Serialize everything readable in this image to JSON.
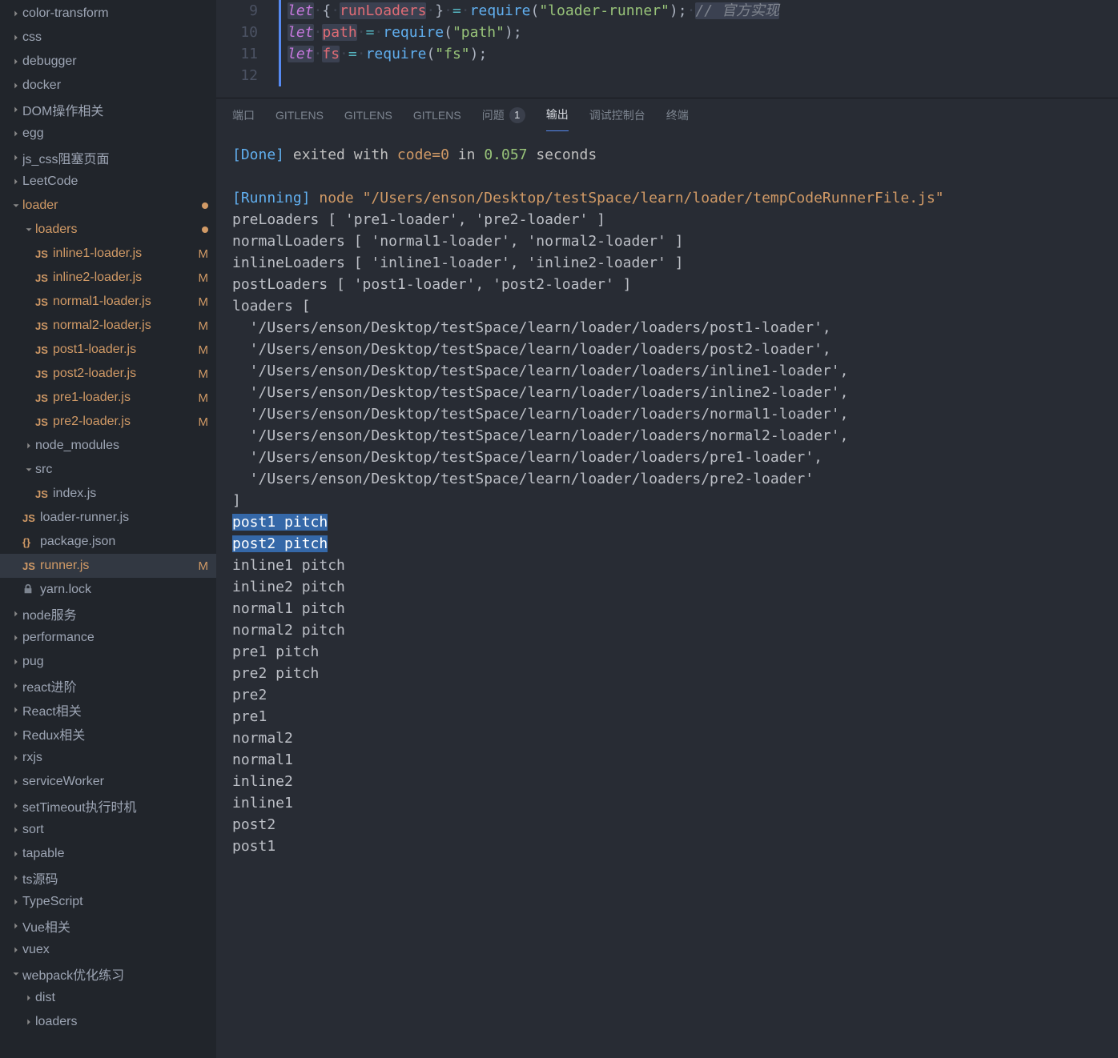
{
  "sidebar": {
    "items": [
      {
        "kind": "folder",
        "expanded": false,
        "depth": 0,
        "name": "color-transform"
      },
      {
        "kind": "folder",
        "expanded": false,
        "depth": 0,
        "name": "css"
      },
      {
        "kind": "folder",
        "expanded": false,
        "depth": 0,
        "name": "debugger"
      },
      {
        "kind": "folder",
        "expanded": false,
        "depth": 0,
        "name": "docker"
      },
      {
        "kind": "folder",
        "expanded": false,
        "depth": 0,
        "name": "DOM操作相关"
      },
      {
        "kind": "folder",
        "expanded": false,
        "depth": 0,
        "name": "egg"
      },
      {
        "kind": "folder",
        "expanded": false,
        "depth": 0,
        "name": "js_css阻塞页面"
      },
      {
        "kind": "folder",
        "expanded": false,
        "depth": 0,
        "name": "LeetCode"
      },
      {
        "kind": "folder",
        "expanded": true,
        "depth": 0,
        "name": "loader",
        "dot": true,
        "mod": true
      },
      {
        "kind": "folder",
        "expanded": true,
        "depth": 1,
        "name": "loaders",
        "dot": true,
        "mod": true
      },
      {
        "kind": "file",
        "icon": "JS",
        "depth": 2,
        "name": "inline1-loader.js",
        "mod": true,
        "marker": "M"
      },
      {
        "kind": "file",
        "icon": "JS",
        "depth": 2,
        "name": "inline2-loader.js",
        "mod": true,
        "marker": "M"
      },
      {
        "kind": "file",
        "icon": "JS",
        "depth": 2,
        "name": "normal1-loader.js",
        "mod": true,
        "marker": "M"
      },
      {
        "kind": "file",
        "icon": "JS",
        "depth": 2,
        "name": "normal2-loader.js",
        "mod": true,
        "marker": "M"
      },
      {
        "kind": "file",
        "icon": "JS",
        "depth": 2,
        "name": "post1-loader.js",
        "mod": true,
        "marker": "M"
      },
      {
        "kind": "file",
        "icon": "JS",
        "depth": 2,
        "name": "post2-loader.js",
        "mod": true,
        "marker": "M"
      },
      {
        "kind": "file",
        "icon": "JS",
        "depth": 2,
        "name": "pre1-loader.js",
        "mod": true,
        "marker": "M"
      },
      {
        "kind": "file",
        "icon": "JS",
        "depth": 2,
        "name": "pre2-loader.js",
        "mod": true,
        "marker": "M"
      },
      {
        "kind": "folder",
        "expanded": false,
        "depth": 1,
        "name": "node_modules"
      },
      {
        "kind": "folder",
        "expanded": true,
        "depth": 1,
        "name": "src"
      },
      {
        "kind": "file",
        "icon": "JS",
        "depth": 2,
        "name": "index.js"
      },
      {
        "kind": "file",
        "icon": "JS",
        "depth": 1,
        "name": "loader-runner.js"
      },
      {
        "kind": "file",
        "icon": "{}",
        "depth": 1,
        "name": "package.json"
      },
      {
        "kind": "file",
        "icon": "JS",
        "depth": 1,
        "name": "runner.js",
        "mod": true,
        "marker": "M",
        "selected": true
      },
      {
        "kind": "file",
        "icon": "🔒",
        "depth": 1,
        "name": "yarn.lock"
      },
      {
        "kind": "folder",
        "expanded": false,
        "depth": 0,
        "name": "node服务"
      },
      {
        "kind": "folder",
        "expanded": false,
        "depth": 0,
        "name": "performance"
      },
      {
        "kind": "folder",
        "expanded": false,
        "depth": 0,
        "name": "pug"
      },
      {
        "kind": "folder",
        "expanded": false,
        "depth": 0,
        "name": "react进阶"
      },
      {
        "kind": "folder",
        "expanded": false,
        "depth": 0,
        "name": "React相关"
      },
      {
        "kind": "folder",
        "expanded": false,
        "depth": 0,
        "name": "Redux相关"
      },
      {
        "kind": "folder",
        "expanded": false,
        "depth": 0,
        "name": "rxjs"
      },
      {
        "kind": "folder",
        "expanded": false,
        "depth": 0,
        "name": "serviceWorker"
      },
      {
        "kind": "folder",
        "expanded": false,
        "depth": 0,
        "name": "setTimeout执行时机"
      },
      {
        "kind": "folder",
        "expanded": false,
        "depth": 0,
        "name": "sort"
      },
      {
        "kind": "folder",
        "expanded": false,
        "depth": 0,
        "name": "tapable"
      },
      {
        "kind": "folder",
        "expanded": false,
        "depth": 0,
        "name": "ts源码"
      },
      {
        "kind": "folder",
        "expanded": false,
        "depth": 0,
        "name": "TypeScript"
      },
      {
        "kind": "folder",
        "expanded": false,
        "depth": 0,
        "name": "Vue相关"
      },
      {
        "kind": "folder",
        "expanded": false,
        "depth": 0,
        "name": "vuex"
      },
      {
        "kind": "folder",
        "expanded": true,
        "depth": 0,
        "name": "webpack优化练习"
      },
      {
        "kind": "folder",
        "expanded": false,
        "depth": 1,
        "name": "dist"
      },
      {
        "kind": "folder",
        "expanded": false,
        "depth": 1,
        "name": "loaders"
      }
    ]
  },
  "editor": {
    "lineNumbers": [
      "9",
      "10",
      "11",
      "12"
    ],
    "code": {
      "l9_let": "let",
      "l9_lb": "{",
      "l9_id": "runLoaders",
      "l9_rb": "}",
      "l9_eq": "=",
      "l9_req": "require",
      "l9_lp": "(",
      "l9_str": "\"loader-runner\"",
      "l9_rp": ")",
      "l9_sc": ";",
      "l9_cmt": "// 官方实现",
      "l10_let": "let",
      "l10_id": "path",
      "l10_eq": "=",
      "l10_req": "require",
      "l10_lp": "(",
      "l10_str": "\"path\"",
      "l10_rp": ")",
      "l10_sc": ";",
      "l11_let": "let",
      "l11_id": "fs",
      "l11_eq": "=",
      "l11_req": "require",
      "l11_lp": "(",
      "l11_str": "\"fs\"",
      "l11_rp": ")",
      "l11_sc": ";"
    }
  },
  "panel": {
    "tabs": {
      "ports": "端口",
      "gitlens1": "GITLENS",
      "gitlens2": "GITLENS",
      "gitlens3": "GITLENS",
      "problems": "问题",
      "problems_count": "1",
      "output": "输出",
      "debug": "调试控制台",
      "terminal": "终端"
    }
  },
  "output": {
    "done_label": "[Done]",
    "done_rest": " exited with ",
    "done_code": "code=0",
    "done_rest2": " in ",
    "done_time": "0.057",
    "done_sec": " seconds",
    "running_label": "[Running]",
    "running_cmd": " node \"/Users/enson/Desktop/testSpace/learn/loader/tempCodeRunnerFile.js\"",
    "lines": [
      "preLoaders [ 'pre1-loader', 'pre2-loader' ]",
      "normalLoaders [ 'normal1-loader', 'normal2-loader' ]",
      "inlineLoaders [ 'inline1-loader', 'inline2-loader' ]",
      "postLoaders [ 'post1-loader', 'post2-loader' ]",
      "loaders [",
      "  '/Users/enson/Desktop/testSpace/learn/loader/loaders/post1-loader',",
      "  '/Users/enson/Desktop/testSpace/learn/loader/loaders/post2-loader',",
      "  '/Users/enson/Desktop/testSpace/learn/loader/loaders/inline1-loader',",
      "  '/Users/enson/Desktop/testSpace/learn/loader/loaders/inline2-loader',",
      "  '/Users/enson/Desktop/testSpace/learn/loader/loaders/normal1-loader',",
      "  '/Users/enson/Desktop/testSpace/learn/loader/loaders/normal2-loader',",
      "  '/Users/enson/Desktop/testSpace/learn/loader/loaders/pre1-loader',",
      "  '/Users/enson/Desktop/testSpace/learn/loader/loaders/pre2-loader'",
      "]"
    ],
    "selected": [
      "post1 pitch",
      "post2 pitch"
    ],
    "lines2": [
      "inline1 pitch",
      "inline2 pitch",
      "normal1 pitch",
      "normal2 pitch",
      "pre1 pitch",
      "pre2 pitch",
      "pre2",
      "pre1",
      "normal2",
      "normal1",
      "inline2",
      "inline1",
      "post2",
      "post1"
    ]
  }
}
